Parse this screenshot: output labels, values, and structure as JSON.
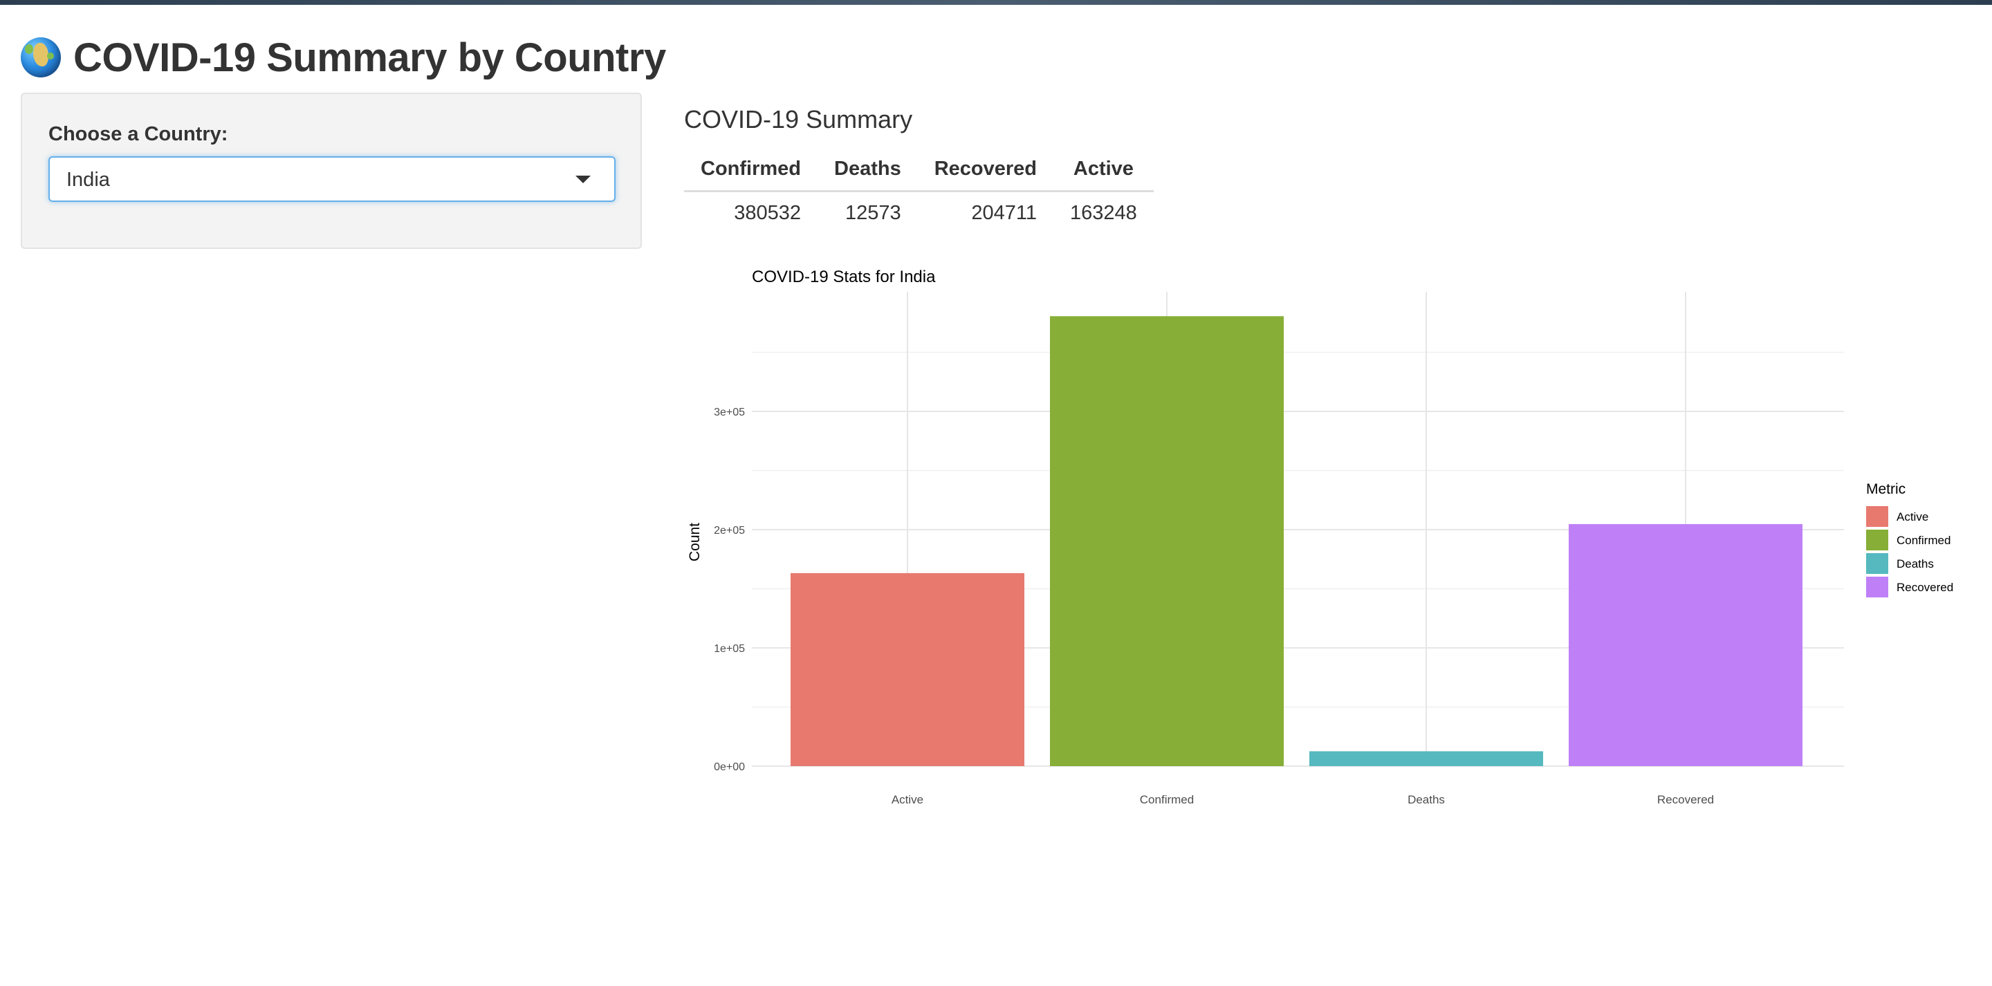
{
  "header": {
    "icon": "globe-icon",
    "title": "COVID-19 Summary by Country"
  },
  "sidebar": {
    "label": "Choose a Country:",
    "select": {
      "value": "India",
      "icon": "chevron-down-icon"
    }
  },
  "summary": {
    "title": "COVID-19 Summary",
    "columns": [
      "Confirmed",
      "Deaths",
      "Recovered",
      "Active"
    ],
    "values": [
      "380532",
      "12573",
      "204711",
      "163248"
    ]
  },
  "chart_data": {
    "type": "bar",
    "title": "COVID-19 Stats for India",
    "xlabel": "",
    "ylabel": "Count",
    "categories": [
      "Active",
      "Confirmed",
      "Deaths",
      "Recovered"
    ],
    "values": [
      163248,
      380532,
      12573,
      204711
    ],
    "colors": [
      "#E7796F",
      "#87AE37",
      "#55B9BF",
      "#BF80F7"
    ],
    "ylim": [
      0,
      400000
    ],
    "y_ticks": [
      0,
      100000,
      200000,
      300000
    ],
    "y_tick_labels": [
      "0e+00",
      "1e+05",
      "2e+05",
      "3e+05"
    ],
    "grid": true,
    "legend": {
      "title": "Metric",
      "position": "right",
      "entries": [
        "Active",
        "Confirmed",
        "Deaths",
        "Recovered"
      ]
    }
  }
}
